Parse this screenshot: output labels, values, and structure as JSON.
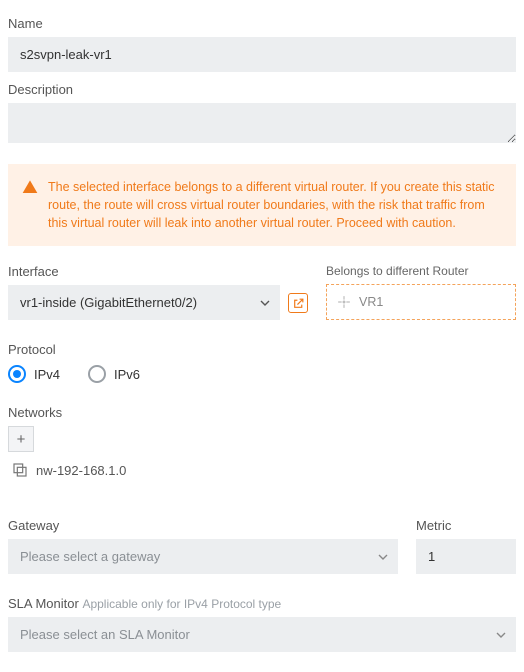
{
  "name": {
    "label": "Name",
    "value": "s2svpn-leak-vr1"
  },
  "description": {
    "label": "Description",
    "value": ""
  },
  "warning": {
    "text": "The selected interface belongs to a different virtual router. If you create this static route, the route will cross virtual router boundaries, with the risk that traffic from this virtual router will leak into another virtual router. Proceed with caution."
  },
  "interface": {
    "label": "Interface",
    "value": "vr1-inside (GigabitEthernet0/2)",
    "belongs_label": "Belongs to different Router",
    "vr_name": "VR1"
  },
  "protocol": {
    "label": "Protocol",
    "option_ipv4": "IPv4",
    "option_ipv6": "IPv6",
    "selected": "ipv4"
  },
  "networks": {
    "label": "Networks",
    "items": [
      "nw-192-168.1.0"
    ]
  },
  "gateway": {
    "label": "Gateway",
    "placeholder": "Please select a gateway"
  },
  "metric": {
    "label": "Metric",
    "value": "1"
  },
  "sla": {
    "label": "SLA Monitor",
    "note": "Applicable only for IPv4 Protocol type",
    "placeholder": "Please select an SLA Monitor"
  }
}
